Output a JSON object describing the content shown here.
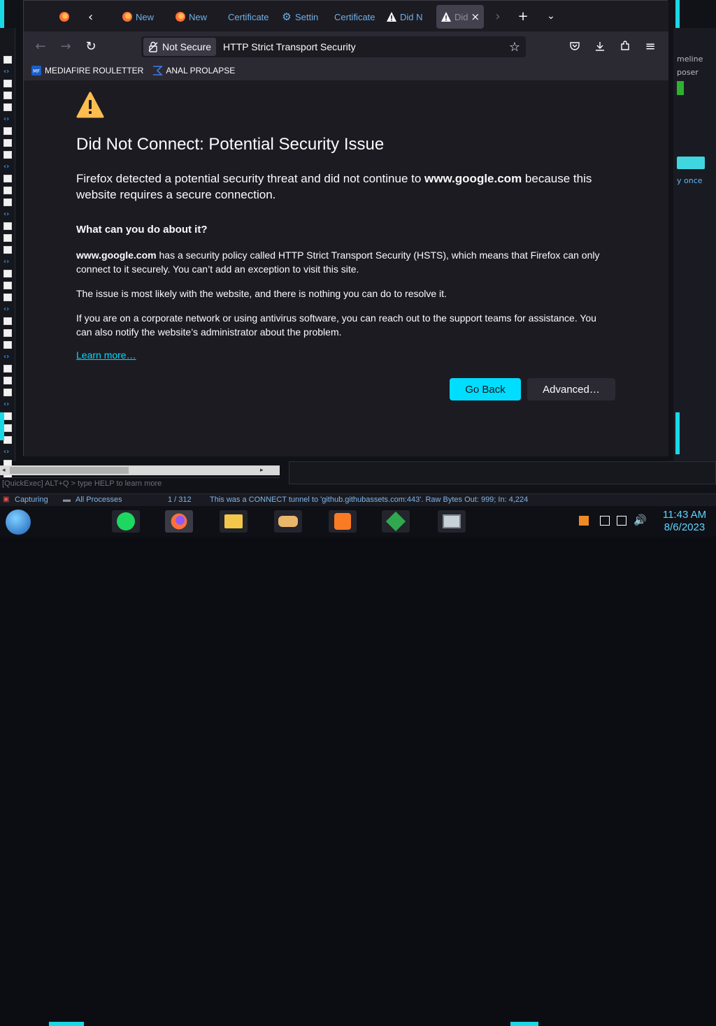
{
  "tabs": [
    {
      "label": "",
      "icon": "firefox-icon"
    },
    {
      "label": "New ",
      "icon": "firefox-icon"
    },
    {
      "label": "New ",
      "icon": "firefox-icon"
    },
    {
      "label": "Certificate",
      "icon": ""
    },
    {
      "label": "Settin",
      "icon": "gear-icon"
    },
    {
      "label": "Certificate",
      "icon": ""
    },
    {
      "label": "Did N",
      "icon": "warning-icon"
    },
    {
      "label": "Did",
      "icon": "warning-icon"
    }
  ],
  "navbar": {
    "not_secure": "Not Secure",
    "url": "HTTP Strict Transport Security"
  },
  "bookmarks": [
    {
      "label": "MEDIAFIRE ROULETTER",
      "icon": "mediafire-icon"
    },
    {
      "label": "ANAL PROLAPSE",
      "icon": "sigma-icon"
    }
  ],
  "error": {
    "title": "Did Not Connect: Potential Security Issue",
    "intro_pre": "Firefox detected a potential security threat and did not continue to ",
    "intro_domain": "www.google.com",
    "intro_post": " because this website requires a secure connection.",
    "what_heading": "What can you do about it?",
    "p1_domain": "www.google.com",
    "p1_rest": " has a security policy called HTTP Strict Transport Security (HSTS), which means that Firefox can only connect to it securely. You can’t add an exception to visit this site.",
    "p2": "The issue is most likely with the website, and there is nothing you can do to resolve it.",
    "p3": "If you are on a corporate network or using antivirus software, you can reach out to the support teams for assistance. You can also notify the website’s administrator about the problem.",
    "learn_more": "Learn more…",
    "go_back": "Go Back",
    "advanced": "Advanced…"
  },
  "background_window": {
    "line1": "meline",
    "line2": "poser",
    "line3": "y once"
  },
  "quickexec": "[QuickExec] ALT+Q > type HELP to learn more",
  "statusbar": {
    "capturing": "Capturing",
    "processes": "All Processes",
    "count": "1 / 312",
    "message": "This was a CONNECT tunnel to 'github.githubassets.com:443'. Raw Bytes Out: 999; In: 4,224"
  },
  "taskbar": {
    "time": "11:43 AM",
    "date": "8/6/2023"
  },
  "colors": {
    "accent": "#00ddff",
    "warning": "#ffbd4f",
    "frame_cyan": "#1ad8e6"
  }
}
